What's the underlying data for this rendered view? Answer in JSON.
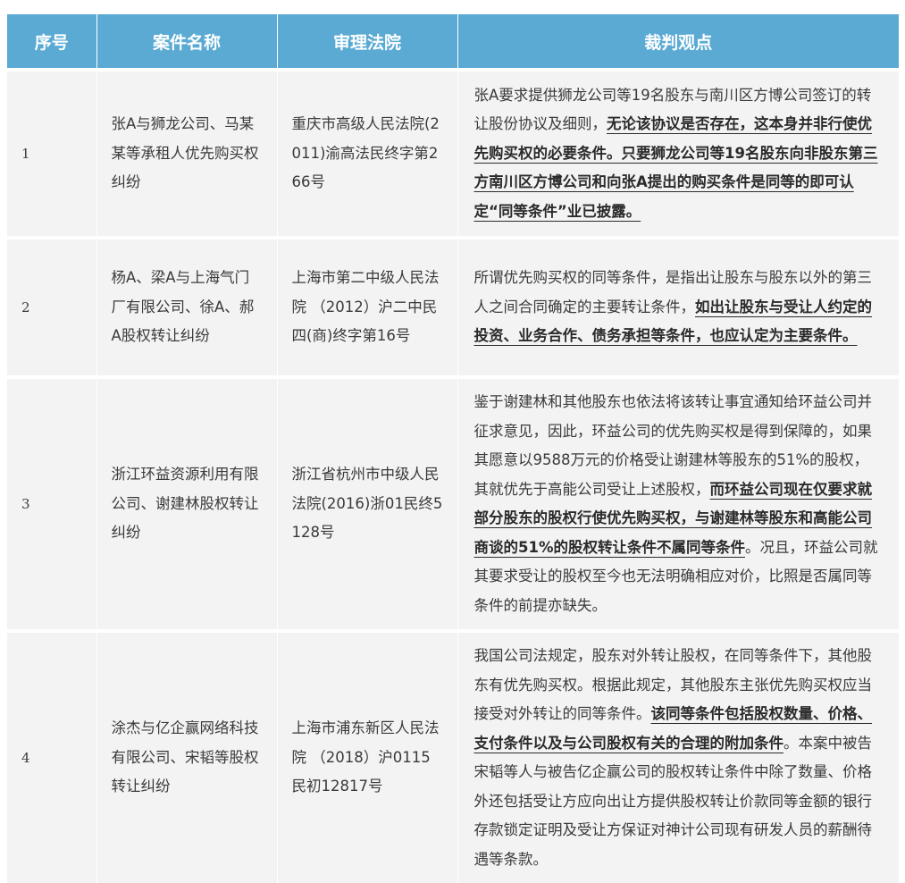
{
  "table": {
    "headers": [
      "序号",
      "案件名称",
      "审理法院",
      "裁判观点"
    ],
    "rows": [
      {
        "index": "1",
        "case_name": "张A与狮龙公司、马某某等承租人优先购买权纠纷",
        "court": "重庆市高级人民法院(2011)渝高法民终字第266号",
        "ruling": {
          "normal_1": "张A要求提供狮龙公司等19名股东与南川区方博公司签订的转让股份协议及细则，",
          "highlight": "无论该协议是否存在，这本身并非行使优先购买权的必要条件。只要狮龙公司等19名股东向非股东第三方南川区方博公司和向张A提出的购买条件是同等的即可认定“同等条件”业已披露。",
          "normal_2": ""
        }
      },
      {
        "index": "2",
        "case_name": "杨A、梁A与上海气门厂有限公司、徐A、郝A股权转让纠纷",
        "court": "上海市第二中级人民法院 （2012）沪二中民四(商)终字第16号",
        "ruling": {
          "normal_1": "所谓优先购买权的同等条件，是指出让股东与股东以外的第三人之间合同确定的主要转让条件，",
          "highlight": "如出让股东与受让人约定的投资、业务合作、债务承担等条件，也应认定为主要条件。",
          "normal_2": ""
        }
      },
      {
        "index": "3",
        "case_name": "浙江环益资源利用有限公司、谢建林股权转让纠纷",
        "court": "浙江省杭州市中级人民法院(2016)浙01民终5128号",
        "ruling": {
          "normal_1": "鉴于谢建林和其他股东也依法将该转让事宜通知给环益公司并征求意见，因此，环益公司的优先购买权是得到保障的，如果其愿意以9588万元的价格受让谢建林等股东的51%的股权，其就优先于高能公司受让上述股权，",
          "highlight": "而环益公司现在仅要求就部分股东的股权行使优先购买权，与谢建林等股东和高能公司商谈的51%的股权转让条件不属同等条件",
          "normal_2": "。况且，环益公司就其要求受让的股权至今也无法明确相应对价，比照是否属同等条件的前提亦缺失。"
        }
      },
      {
        "index": "4",
        "case_name": "涂杰与亿企赢网络科技有限公司、宋韬等股权转让纠纷",
        "court": "上海市浦东新区人民法院 （2018）沪0115民初12817号",
        "ruling": {
          "normal_1": "我国公司法规定，股东对外转让股权，在同等条件下，其他股东有优先购买权。根据此规定，其他股东主张优先购买权应当接受对外转让的同等条件。",
          "highlight": "该同等条件包括股权数量、价格、支付条件以及与公司股权有关的合理的附加条件",
          "normal_2": "。本案中被告宋韬等人与被告亿企赢公司的股权转让条件中除了数量、价格外还包括受让方应向出让方提供股权转让价款同等金额的银行存款锁定证明及受让方保证对神计公司现有研发人员的薪酬待遇等条款。"
        }
      }
    ]
  }
}
